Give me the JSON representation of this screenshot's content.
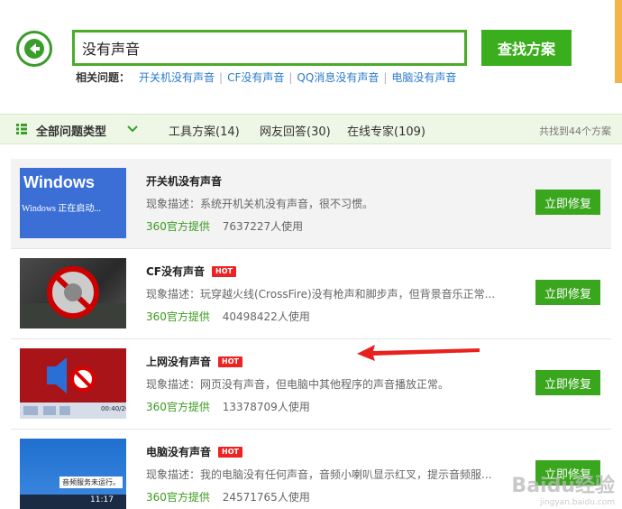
{
  "header": {
    "search_value": "没有声音",
    "search_button": "查找方案",
    "related_label": "相关问题：",
    "related_links": [
      "开关机没有声音",
      "CF没有声音",
      "QQ消息没有声音",
      "电脑没有声音"
    ]
  },
  "filter": {
    "all_types": "全部问题类型",
    "tabs": [
      "工具方案(14)",
      "网友回答(30)",
      "在线专家(109)"
    ],
    "total": "共找到44个方案"
  },
  "items": [
    {
      "title": "开关机没有声音",
      "hot": "",
      "desc": "现象描述：系统开机关机没有声音，很不习惯。",
      "source": "360官方提供",
      "usage": "7637227人使用",
      "button": "立即修复",
      "thumb_text_a": "Windows",
      "thumb_text_b": "Windows 正在启动..."
    },
    {
      "title": "CF没有声音",
      "hot": "HOT",
      "desc": "现象描述：玩穿越火线(CrossFire)没有枪声和脚步声，但背景音乐正常...",
      "source": "360官方提供",
      "usage": "40498422人使用",
      "button": "立即修复"
    },
    {
      "title": "上网没有声音",
      "hot": "HOT",
      "desc": "现象描述：网页没有声音，但电脑中其他程序的声音播放正常。",
      "source": "360官方提供",
      "usage": "13378709人使用",
      "button": "立即修复",
      "thumb_time": "00:40/264"
    },
    {
      "title": "电脑没有声音",
      "hot": "HOT",
      "desc": "现象描述：我的电脑没有任何声音，音频小喇叭显示红叉，提示音频服...",
      "source": "360官方提供",
      "usage": "24571765人使用",
      "button": "立即修复",
      "thumb_text_a": "音频服务未运行。",
      "thumb_text_b": "11:17"
    }
  ],
  "watermark": {
    "main": "Baidu经验",
    "sub": "jingyan.baidu.com"
  },
  "colors": {
    "brand_green": "#3aae1c",
    "link_blue": "#2a7acb",
    "hot_red": "#e22222",
    "annotation_red": "#e8201e"
  }
}
